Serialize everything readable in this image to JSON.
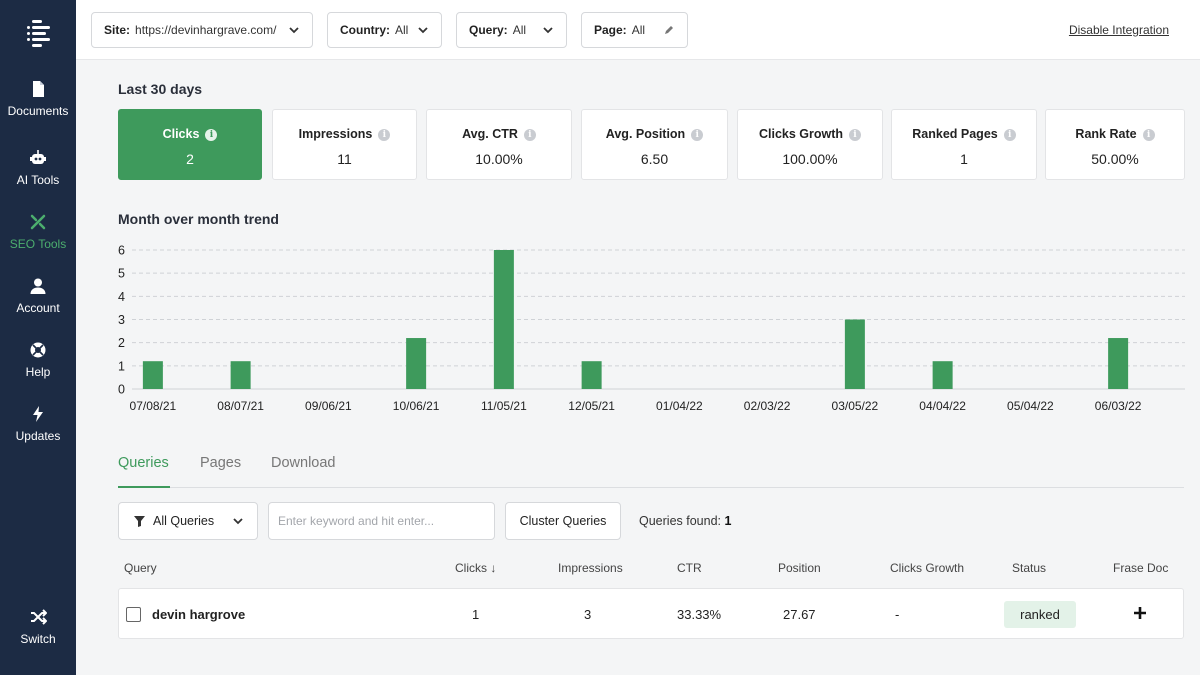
{
  "colors": {
    "accent": "#3e9a5c",
    "sidebar": "#1c2b44",
    "bar": "#3e9a5c"
  },
  "sidebar": {
    "logo": "frase-logo",
    "items": [
      {
        "label": "Documents",
        "icon": "document-icon"
      },
      {
        "label": "AI Tools",
        "icon": "robot-icon"
      },
      {
        "label": "SEO Tools",
        "icon": "tools-icon",
        "active": true
      },
      {
        "label": "Account",
        "icon": "user-icon"
      },
      {
        "label": "Help",
        "icon": "lifebuoy-icon"
      },
      {
        "label": "Updates",
        "icon": "bolt-icon"
      }
    ],
    "switch_label": "Switch"
  },
  "filters": {
    "site": {
      "label": "Site:",
      "value": "https://devinhargrave.com/"
    },
    "country": {
      "label": "Country:",
      "value": "All"
    },
    "query": {
      "label": "Query:",
      "value": "All"
    },
    "page": {
      "label": "Page:",
      "value": "All"
    },
    "disable_link": "Disable Integration"
  },
  "period_label": "Last 30 days",
  "metrics": [
    {
      "title": "Clicks",
      "value": "2",
      "active": true
    },
    {
      "title": "Impressions",
      "value": "11"
    },
    {
      "title": "Avg. CTR",
      "value": "10.00%"
    },
    {
      "title": "Avg. Position",
      "value": "6.50"
    },
    {
      "title": "Clicks Growth",
      "value": "100.00%"
    },
    {
      "title": "Ranked Pages",
      "value": "1"
    },
    {
      "title": "Rank Rate",
      "value": "50.00%"
    }
  ],
  "trend_title": "Month over month trend",
  "chart_data": {
    "type": "bar",
    "categories": [
      "07/08/21",
      "08/07/21",
      "09/06/21",
      "10/06/21",
      "11/05/21",
      "12/05/21",
      "01/04/22",
      "02/03/22",
      "03/05/22",
      "04/04/22",
      "05/04/22",
      "06/03/22"
    ],
    "values": [
      1.2,
      1.2,
      0,
      2.2,
      6,
      1.2,
      0,
      0,
      3,
      1.2,
      0,
      2.2
    ],
    "yticks": [
      "0",
      "1",
      "2",
      "3",
      "4",
      "5",
      "6"
    ],
    "ylim": [
      0,
      6
    ],
    "grid": true,
    "title": "",
    "xlabel": "",
    "ylabel": ""
  },
  "tabs": [
    {
      "label": "Queries",
      "active": true
    },
    {
      "label": "Pages"
    },
    {
      "label": "Download"
    }
  ],
  "toolbar": {
    "filter_value": "All Queries",
    "search_placeholder": "Enter keyword and hit enter...",
    "cluster_label": "Cluster Queries",
    "found_label": "Queries found:",
    "found_count": "1"
  },
  "table": {
    "headers": {
      "query": "Query",
      "clicks": "Clicks ↓",
      "impressions": "Impressions",
      "ctr": "CTR",
      "position": "Position",
      "growth": "Clicks Growth",
      "status": "Status",
      "doc": "Frase Doc"
    },
    "rows": [
      {
        "query": "devin hargrove",
        "clicks": "1",
        "impressions": "3",
        "ctr": "33.33%",
        "position": "27.67",
        "growth": "-",
        "status": "ranked"
      }
    ]
  }
}
